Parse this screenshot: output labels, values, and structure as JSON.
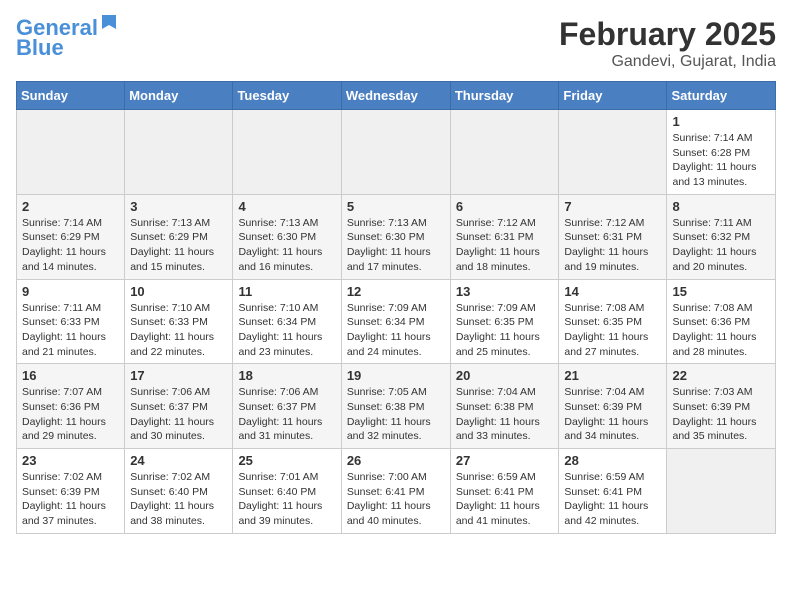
{
  "header": {
    "logo_line1": "General",
    "logo_line2": "Blue",
    "month_year": "February 2025",
    "location": "Gandevi, Gujarat, India"
  },
  "weekdays": [
    "Sunday",
    "Monday",
    "Tuesday",
    "Wednesday",
    "Thursday",
    "Friday",
    "Saturday"
  ],
  "weeks": [
    [
      {
        "day": "",
        "info": ""
      },
      {
        "day": "",
        "info": ""
      },
      {
        "day": "",
        "info": ""
      },
      {
        "day": "",
        "info": ""
      },
      {
        "day": "",
        "info": ""
      },
      {
        "day": "",
        "info": ""
      },
      {
        "day": "1",
        "info": "Sunrise: 7:14 AM\nSunset: 6:28 PM\nDaylight: 11 hours\nand 13 minutes."
      }
    ],
    [
      {
        "day": "2",
        "info": "Sunrise: 7:14 AM\nSunset: 6:29 PM\nDaylight: 11 hours\nand 14 minutes."
      },
      {
        "day": "3",
        "info": "Sunrise: 7:13 AM\nSunset: 6:29 PM\nDaylight: 11 hours\nand 15 minutes."
      },
      {
        "day": "4",
        "info": "Sunrise: 7:13 AM\nSunset: 6:30 PM\nDaylight: 11 hours\nand 16 minutes."
      },
      {
        "day": "5",
        "info": "Sunrise: 7:13 AM\nSunset: 6:30 PM\nDaylight: 11 hours\nand 17 minutes."
      },
      {
        "day": "6",
        "info": "Sunrise: 7:12 AM\nSunset: 6:31 PM\nDaylight: 11 hours\nand 18 minutes."
      },
      {
        "day": "7",
        "info": "Sunrise: 7:12 AM\nSunset: 6:31 PM\nDaylight: 11 hours\nand 19 minutes."
      },
      {
        "day": "8",
        "info": "Sunrise: 7:11 AM\nSunset: 6:32 PM\nDaylight: 11 hours\nand 20 minutes."
      }
    ],
    [
      {
        "day": "9",
        "info": "Sunrise: 7:11 AM\nSunset: 6:33 PM\nDaylight: 11 hours\nand 21 minutes."
      },
      {
        "day": "10",
        "info": "Sunrise: 7:10 AM\nSunset: 6:33 PM\nDaylight: 11 hours\nand 22 minutes."
      },
      {
        "day": "11",
        "info": "Sunrise: 7:10 AM\nSunset: 6:34 PM\nDaylight: 11 hours\nand 23 minutes."
      },
      {
        "day": "12",
        "info": "Sunrise: 7:09 AM\nSunset: 6:34 PM\nDaylight: 11 hours\nand 24 minutes."
      },
      {
        "day": "13",
        "info": "Sunrise: 7:09 AM\nSunset: 6:35 PM\nDaylight: 11 hours\nand 25 minutes."
      },
      {
        "day": "14",
        "info": "Sunrise: 7:08 AM\nSunset: 6:35 PM\nDaylight: 11 hours\nand 27 minutes."
      },
      {
        "day": "15",
        "info": "Sunrise: 7:08 AM\nSunset: 6:36 PM\nDaylight: 11 hours\nand 28 minutes."
      }
    ],
    [
      {
        "day": "16",
        "info": "Sunrise: 7:07 AM\nSunset: 6:36 PM\nDaylight: 11 hours\nand 29 minutes."
      },
      {
        "day": "17",
        "info": "Sunrise: 7:06 AM\nSunset: 6:37 PM\nDaylight: 11 hours\nand 30 minutes."
      },
      {
        "day": "18",
        "info": "Sunrise: 7:06 AM\nSunset: 6:37 PM\nDaylight: 11 hours\nand 31 minutes."
      },
      {
        "day": "19",
        "info": "Sunrise: 7:05 AM\nSunset: 6:38 PM\nDaylight: 11 hours\nand 32 minutes."
      },
      {
        "day": "20",
        "info": "Sunrise: 7:04 AM\nSunset: 6:38 PM\nDaylight: 11 hours\nand 33 minutes."
      },
      {
        "day": "21",
        "info": "Sunrise: 7:04 AM\nSunset: 6:39 PM\nDaylight: 11 hours\nand 34 minutes."
      },
      {
        "day": "22",
        "info": "Sunrise: 7:03 AM\nSunset: 6:39 PM\nDaylight: 11 hours\nand 35 minutes."
      }
    ],
    [
      {
        "day": "23",
        "info": "Sunrise: 7:02 AM\nSunset: 6:39 PM\nDaylight: 11 hours\nand 37 minutes."
      },
      {
        "day": "24",
        "info": "Sunrise: 7:02 AM\nSunset: 6:40 PM\nDaylight: 11 hours\nand 38 minutes."
      },
      {
        "day": "25",
        "info": "Sunrise: 7:01 AM\nSunset: 6:40 PM\nDaylight: 11 hours\nand 39 minutes."
      },
      {
        "day": "26",
        "info": "Sunrise: 7:00 AM\nSunset: 6:41 PM\nDaylight: 11 hours\nand 40 minutes."
      },
      {
        "day": "27",
        "info": "Sunrise: 6:59 AM\nSunset: 6:41 PM\nDaylight: 11 hours\nand 41 minutes."
      },
      {
        "day": "28",
        "info": "Sunrise: 6:59 AM\nSunset: 6:41 PM\nDaylight: 11 hours\nand 42 minutes."
      },
      {
        "day": "",
        "info": ""
      }
    ]
  ]
}
